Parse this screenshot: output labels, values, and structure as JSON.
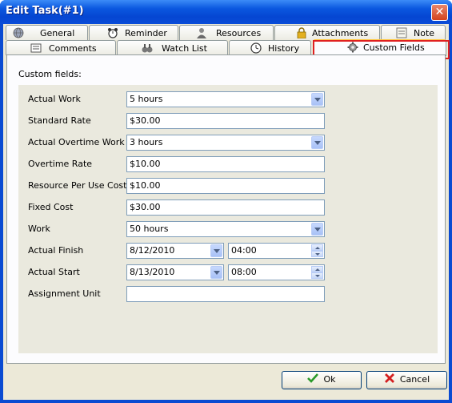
{
  "window": {
    "title": "Edit Task(#1)",
    "close_glyph": "✕"
  },
  "tabs_row1": [
    {
      "label": "General",
      "icon": "globe-icon"
    },
    {
      "label": "Reminder",
      "icon": "alarm-clock-icon"
    },
    {
      "label": "Resources",
      "icon": "person-icon"
    },
    {
      "label": "Attachments",
      "icon": "padlock-icon"
    },
    {
      "label": "Note",
      "icon": "pushpin-icon"
    }
  ],
  "tabs_row2": [
    {
      "label": "Comments",
      "icon": "comments-icon"
    },
    {
      "label": "Watch List",
      "icon": "binoculars-icon"
    },
    {
      "label": "History",
      "icon": "clock-icon"
    },
    {
      "label": "Custom Fields",
      "icon": "gear-icon",
      "active": true
    }
  ],
  "panel": {
    "section_label": "Custom fields:"
  },
  "fields": {
    "actual_work": {
      "label": "Actual Work",
      "value": "5 hours"
    },
    "standard_rate": {
      "label": "Standard Rate",
      "value": "$30.00"
    },
    "actual_overtime_work": {
      "label": "Actual Overtime Work",
      "value": "3 hours"
    },
    "overtime_rate": {
      "label": "Overtime Rate",
      "value": "$10.00"
    },
    "resource_per_use_cost": {
      "label": "Resource Per Use Cost",
      "value": "$10.00"
    },
    "fixed_cost": {
      "label": "Fixed Cost",
      "value": "$30.00"
    },
    "work": {
      "label": "Work",
      "value": "50 hours"
    },
    "actual_finish": {
      "label": "Actual Finish",
      "date": "8/12/2010",
      "time": "04:00"
    },
    "actual_start": {
      "label": "Actual Start",
      "date": "8/13/2010",
      "time": "08:00"
    },
    "assignment_unit": {
      "label": "Assignment Unit",
      "value": ""
    }
  },
  "buttons": {
    "ok_label": "Ok",
    "cancel_label": "Cancel"
  },
  "colors": {
    "highlight": "#e02020",
    "ok_check": "#2a9a2a",
    "cancel_x": "#d42020"
  }
}
